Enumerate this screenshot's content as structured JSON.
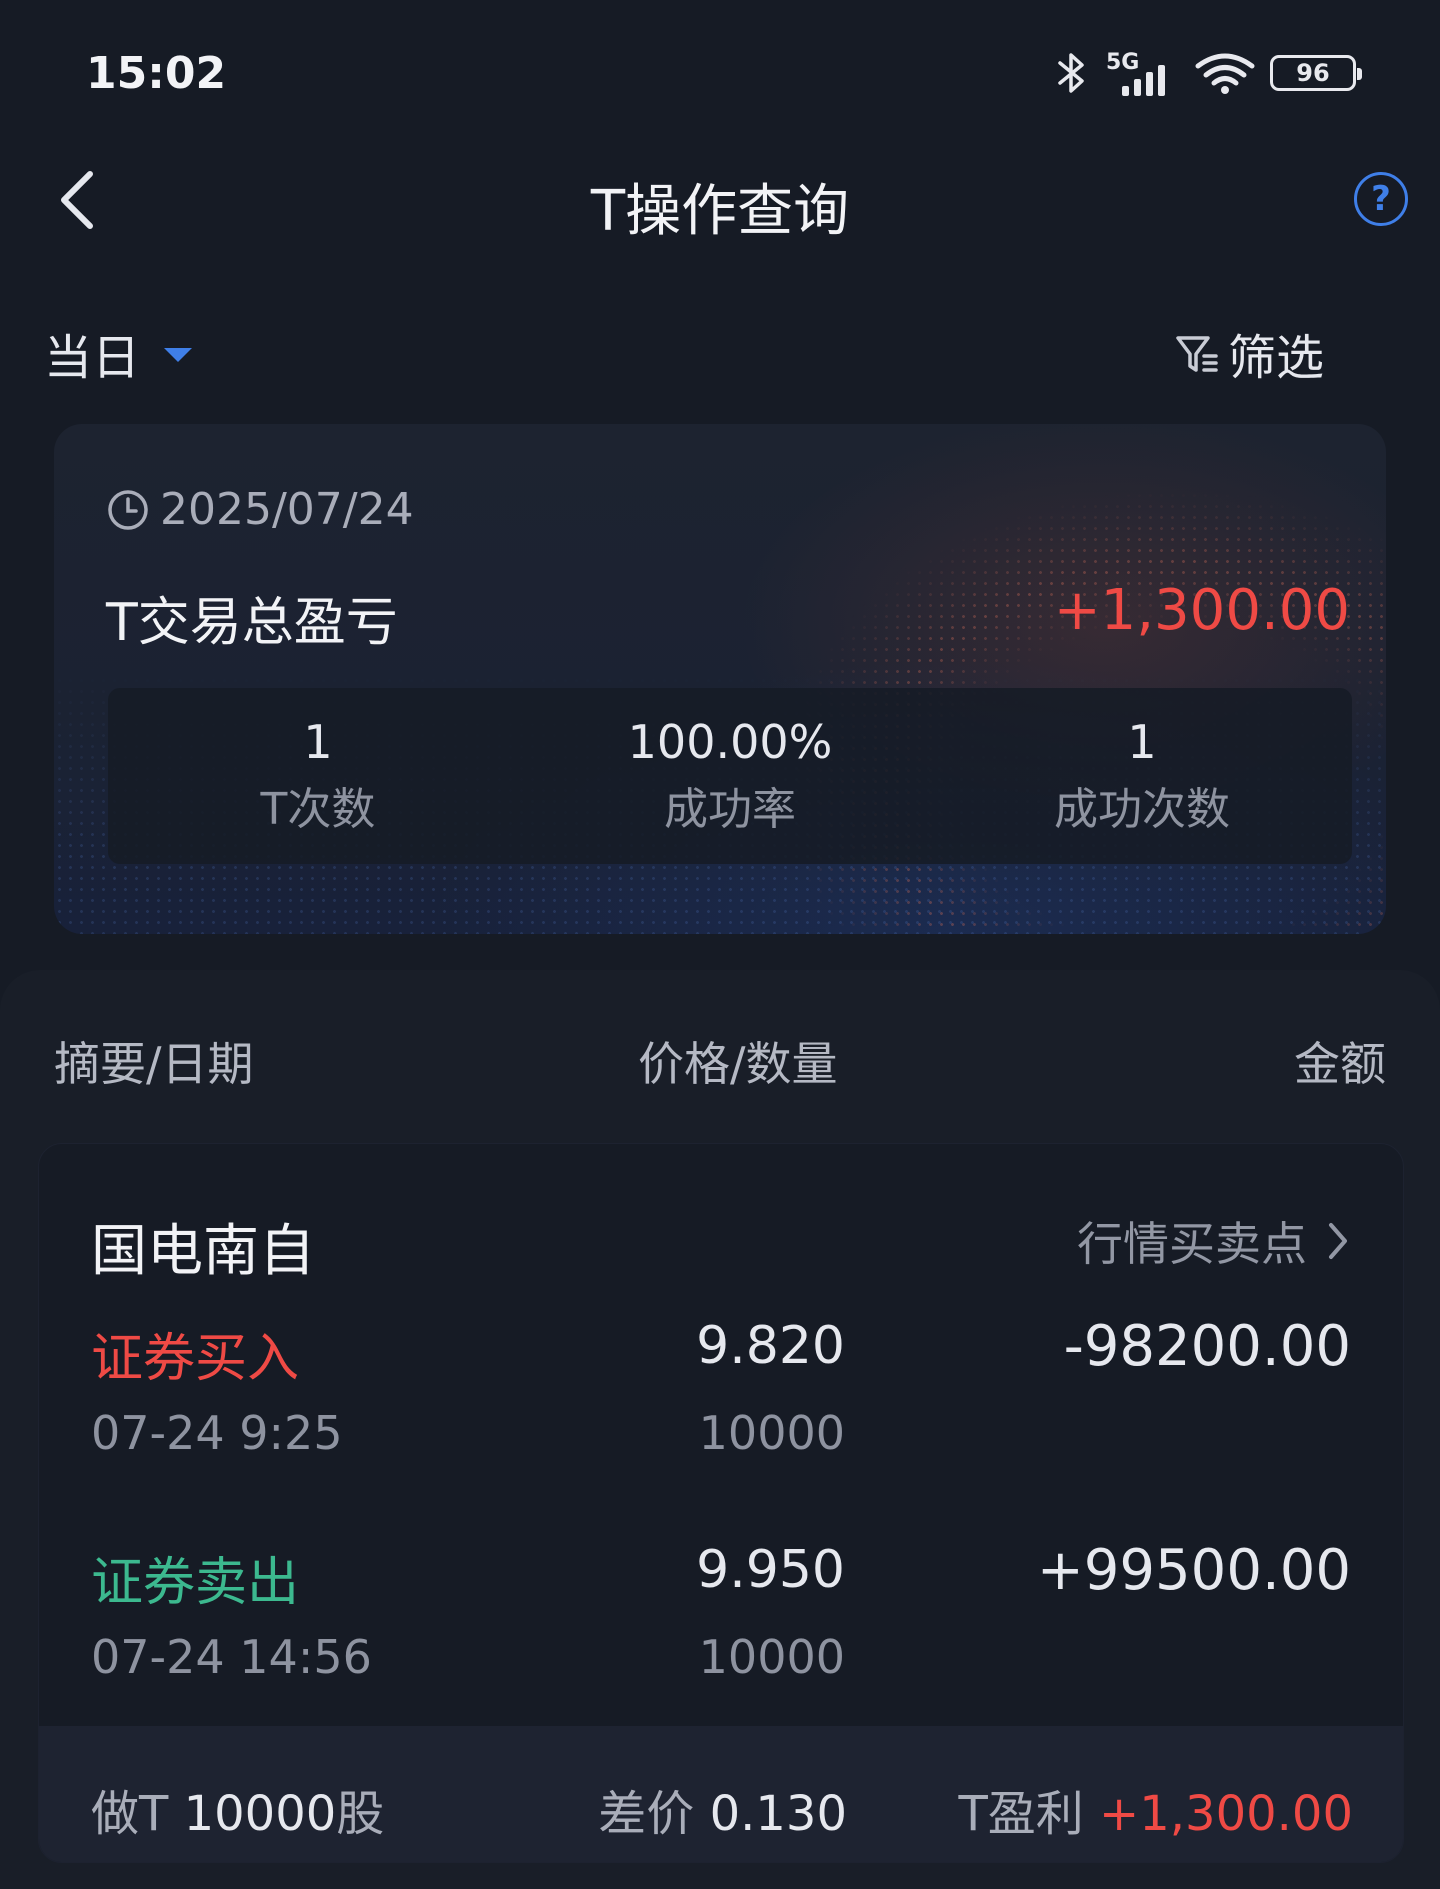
{
  "status_bar": {
    "time": "15:02",
    "network": "5G",
    "battery": "96"
  },
  "header": {
    "title": "T操作查询"
  },
  "filter": {
    "period": "当日",
    "filter_label": "筛选"
  },
  "summary": {
    "date": "2025/07/24",
    "total_label": "T交易总盈亏",
    "total_value": "+1,300.00",
    "stats": [
      {
        "value": "1",
        "label": "T次数"
      },
      {
        "value": "100.00%",
        "label": "成功率"
      },
      {
        "value": "1",
        "label": "成功次数"
      }
    ]
  },
  "table_header": {
    "col1": "摘要/日期",
    "col2": "价格/数量",
    "col3": "金额"
  },
  "trade": {
    "stock_name": "国电南自",
    "market_link": "行情买卖点",
    "rows": [
      {
        "type": "证券买入",
        "datetime": "07-24 9:25",
        "price": "9.820",
        "quantity": "10000",
        "amount": "-98200.00"
      },
      {
        "type": "证券卖出",
        "datetime": "07-24 14:56",
        "price": "9.950",
        "quantity": "10000",
        "amount": "+99500.00"
      }
    ],
    "footer": {
      "shares_label": "做T",
      "shares_value": "10000",
      "shares_unit": "股",
      "diff_label": "差价",
      "diff_value": "0.130",
      "profit_label": "T盈利",
      "profit_value": "+1,300.00"
    }
  },
  "colors": {
    "buy": "#ef4a45",
    "sell": "#3cb98f",
    "accent": "#3f7fe8",
    "profit": "#ef4a45"
  }
}
